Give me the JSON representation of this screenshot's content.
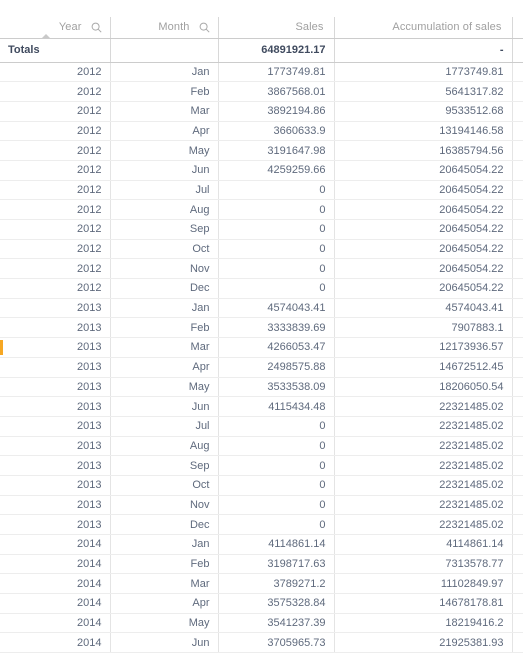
{
  "table": {
    "columns": [
      {
        "label": "Year",
        "align": "right",
        "icon": "search-icon",
        "sorted": true,
        "sort_dir": "asc"
      },
      {
        "label": "Month",
        "align": "right",
        "icon": "search-icon",
        "sorted": false,
        "sort_dir": ""
      },
      {
        "label": "Sales",
        "align": "right",
        "icon": "",
        "sorted": false,
        "sort_dir": ""
      },
      {
        "label": "Accumulation of sales",
        "align": "right",
        "icon": "",
        "sorted": false,
        "sort_dir": ""
      }
    ],
    "totals": {
      "label": "Totals",
      "month": "",
      "sales": "64891921.17",
      "accumulation": "-"
    },
    "rows": [
      {
        "year": "2012",
        "month": "Jan",
        "sales": "1773749.81",
        "accumulation": "1773749.81",
        "selected": false
      },
      {
        "year": "2012",
        "month": "Feb",
        "sales": "3867568.01",
        "accumulation": "5641317.82",
        "selected": false
      },
      {
        "year": "2012",
        "month": "Mar",
        "sales": "3892194.86",
        "accumulation": "9533512.68",
        "selected": false
      },
      {
        "year": "2012",
        "month": "Apr",
        "sales": "3660633.9",
        "accumulation": "13194146.58",
        "selected": false
      },
      {
        "year": "2012",
        "month": "May",
        "sales": "3191647.98",
        "accumulation": "16385794.56",
        "selected": false
      },
      {
        "year": "2012",
        "month": "Jun",
        "sales": "4259259.66",
        "accumulation": "20645054.22",
        "selected": false
      },
      {
        "year": "2012",
        "month": "Jul",
        "sales": "0",
        "accumulation": "20645054.22",
        "selected": false
      },
      {
        "year": "2012",
        "month": "Aug",
        "sales": "0",
        "accumulation": "20645054.22",
        "selected": false
      },
      {
        "year": "2012",
        "month": "Sep",
        "sales": "0",
        "accumulation": "20645054.22",
        "selected": false
      },
      {
        "year": "2012",
        "month": "Oct",
        "sales": "0",
        "accumulation": "20645054.22",
        "selected": false
      },
      {
        "year": "2012",
        "month": "Nov",
        "sales": "0",
        "accumulation": "20645054.22",
        "selected": false
      },
      {
        "year": "2012",
        "month": "Dec",
        "sales": "0",
        "accumulation": "20645054.22",
        "selected": false
      },
      {
        "year": "2013",
        "month": "Jan",
        "sales": "4574043.41",
        "accumulation": "4574043.41",
        "selected": false
      },
      {
        "year": "2013",
        "month": "Feb",
        "sales": "3333839.69",
        "accumulation": "7907883.1",
        "selected": false
      },
      {
        "year": "2013",
        "month": "Mar",
        "sales": "4266053.47",
        "accumulation": "12173936.57",
        "selected": true
      },
      {
        "year": "2013",
        "month": "Apr",
        "sales": "2498575.88",
        "accumulation": "14672512.45",
        "selected": false
      },
      {
        "year": "2013",
        "month": "May",
        "sales": "3533538.09",
        "accumulation": "18206050.54",
        "selected": false
      },
      {
        "year": "2013",
        "month": "Jun",
        "sales": "4115434.48",
        "accumulation": "22321485.02",
        "selected": false
      },
      {
        "year": "2013",
        "month": "Jul",
        "sales": "0",
        "accumulation": "22321485.02",
        "selected": false
      },
      {
        "year": "2013",
        "month": "Aug",
        "sales": "0",
        "accumulation": "22321485.02",
        "selected": false
      },
      {
        "year": "2013",
        "month": "Sep",
        "sales": "0",
        "accumulation": "22321485.02",
        "selected": false
      },
      {
        "year": "2013",
        "month": "Oct",
        "sales": "0",
        "accumulation": "22321485.02",
        "selected": false
      },
      {
        "year": "2013",
        "month": "Nov",
        "sales": "0",
        "accumulation": "22321485.02",
        "selected": false
      },
      {
        "year": "2013",
        "month": "Dec",
        "sales": "0",
        "accumulation": "22321485.02",
        "selected": false
      },
      {
        "year": "2014",
        "month": "Jan",
        "sales": "4114861.14",
        "accumulation": "4114861.14",
        "selected": false
      },
      {
        "year": "2014",
        "month": "Feb",
        "sales": "3198717.63",
        "accumulation": "7313578.77",
        "selected": false
      },
      {
        "year": "2014",
        "month": "Mar",
        "sales": "3789271.2",
        "accumulation": "11102849.97",
        "selected": false
      },
      {
        "year": "2014",
        "month": "Apr",
        "sales": "3575328.84",
        "accumulation": "14678178.81",
        "selected": false
      },
      {
        "year": "2014",
        "month": "May",
        "sales": "3541237.39",
        "accumulation": "18219416.2",
        "selected": false
      },
      {
        "year": "2014",
        "month": "Jun",
        "sales": "3705965.73",
        "accumulation": "21925381.93",
        "selected": false
      }
    ]
  },
  "colors": {
    "selection_marker": "#f6a723",
    "header_text": "#a0a0a0",
    "totals_text": "#404b5f",
    "cell_text": "#5f6a7d",
    "grid_line": "#ededed"
  }
}
